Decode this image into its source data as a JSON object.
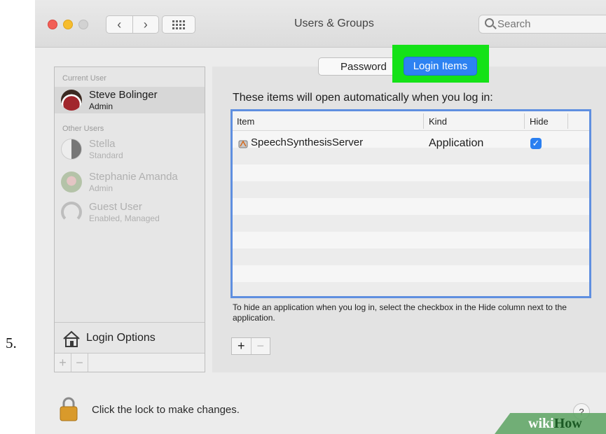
{
  "step_number": "5.",
  "window": {
    "title": "Users & Groups",
    "search_placeholder": "Search"
  },
  "users": {
    "current_header": "Current User",
    "current": {
      "name": "Steve Bolinger",
      "role": "Admin"
    },
    "other_header": "Other Users",
    "others": [
      {
        "name": "Stella",
        "role": "Standard"
      },
      {
        "name": "Stephanie Amanda",
        "role": "Admin"
      },
      {
        "name": "Guest User",
        "role": "Enabled, Managed"
      }
    ],
    "login_options": "Login Options",
    "add": "+",
    "remove": "−"
  },
  "tabs": {
    "password": "Password",
    "login_items": "Login Items"
  },
  "login_items": {
    "heading": "These items will open automatically when you log in:",
    "columns": {
      "item": "Item",
      "kind": "Kind",
      "hide": "Hide"
    },
    "rows": [
      {
        "item": "SpeechSynthesisServer",
        "kind": "Application",
        "hide": "✓"
      }
    ],
    "hint": "To hide an application when you log in, select the checkbox in the Hide column next to the application.",
    "add": "+",
    "remove": "−"
  },
  "footer": {
    "lock_text": "Click the lock to make changes.",
    "help": "?"
  },
  "watermark": {
    "part1": "wiki",
    "part2": "How"
  },
  "colors": {
    "highlight": "#14e217",
    "selected_tab": "#2d82f2",
    "table_focus_border": "#5f8fe0"
  }
}
